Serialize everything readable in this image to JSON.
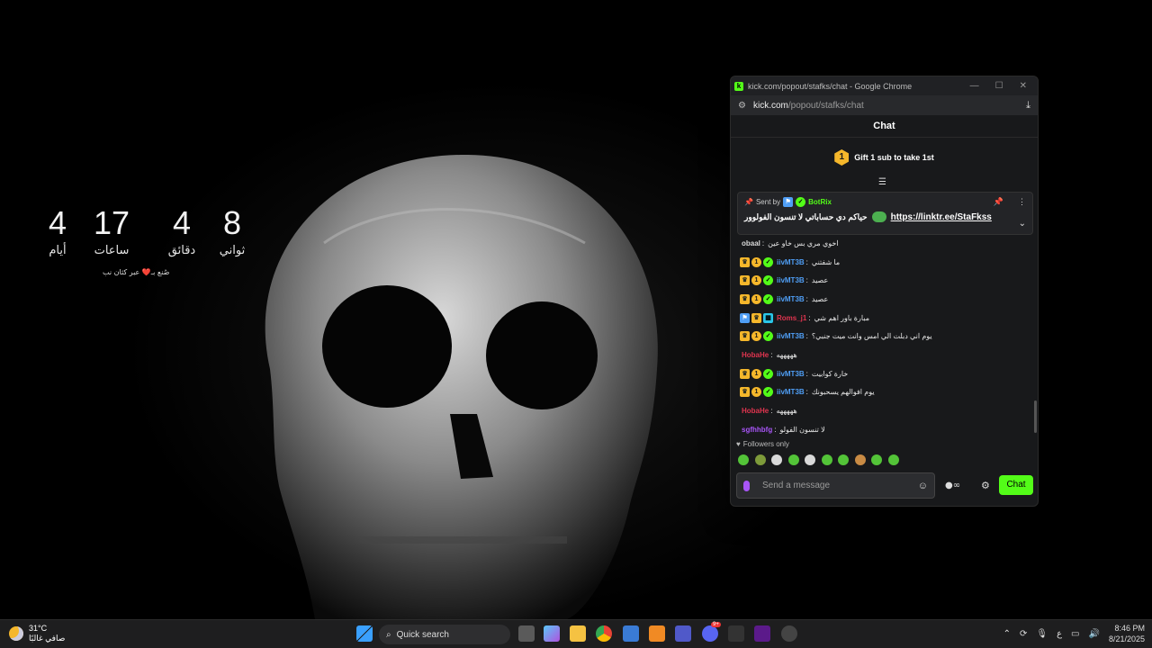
{
  "countdown": {
    "units": [
      {
        "value": "4",
        "label": "أيام"
      },
      {
        "value": "17",
        "label": "ساعات"
      },
      {
        "value": "4",
        "label": "دقائق"
      },
      {
        "value": "8",
        "label": "ثواني"
      }
    ],
    "footer": "صُنع بـ❤️ عبر كثان نب"
  },
  "window": {
    "title": "kick.com/popout/stafks/chat - Google Chrome",
    "url_host": "kick.com",
    "url_path": "/popout/stafks/chat"
  },
  "chat": {
    "header": "Chat",
    "gift_count": "1",
    "gift_text": "Gift 1 sub to take 1st",
    "pinned": {
      "sent_by_label": "Sent by",
      "sender": "BotRix",
      "message": "حياكم دي حساباتي لا تنسون الفولوور",
      "link": "https://linktr.ee/StaFkss"
    },
    "messages": [
      {
        "user": "obaal",
        "color": "#d9d9d9",
        "text": "اخوي مري بس خاو عين",
        "badges": []
      },
      {
        "user": "iivMT3B",
        "color": "#4f9ef5",
        "text": "ما شفتني",
        "badges": [
          "crown",
          "one",
          "verified"
        ]
      },
      {
        "user": "iivMT3B",
        "color": "#4f9ef5",
        "text": "عصيد",
        "badges": [
          "crown",
          "one",
          "verified"
        ]
      },
      {
        "user": "iivMT3B",
        "color": "#4f9ef5",
        "text": "عصيد",
        "badges": [
          "crown",
          "one",
          "verified"
        ]
      },
      {
        "user": "Roms_j1",
        "color": "#e0344f",
        "text": "مبارة باور اهم شي",
        "badges": [
          "blue",
          "crown",
          "og"
        ]
      },
      {
        "user": "iivMT3B",
        "color": "#4f9ef5",
        "text": "يوم اني دبلت الي امس وانت ميت جنبي؟",
        "badges": [
          "crown",
          "one",
          "verified"
        ]
      },
      {
        "user": "HobaHe",
        "color": "#e0344f",
        "text": "هههههه",
        "badges": []
      },
      {
        "user": "iivMT3B",
        "color": "#4f9ef5",
        "text": "خارة كوابيت",
        "badges": [
          "crown",
          "one",
          "verified"
        ]
      },
      {
        "user": "iivMT3B",
        "color": "#4f9ef5",
        "text": "يوم افوالهم يسحبونك",
        "badges": [
          "crown",
          "one",
          "verified"
        ]
      },
      {
        "user": "HobaHe",
        "color": "#e0344f",
        "text": "هههههه",
        "badges": []
      },
      {
        "user": "sgfhhbfg",
        "color": "#a855f7",
        "text": "لا تنسون الفولو",
        "badges": []
      }
    ],
    "followers_only": "Followers only",
    "input_placeholder": "Send a message",
    "send_label": "Chat"
  },
  "taskbar": {
    "temperature": "31°C",
    "weather": "صافي غالبًا",
    "search_placeholder": "Quick search",
    "time": "8:46 PM",
    "date": "8/21/2025",
    "lang": "ع",
    "discord_badge": "9+"
  },
  "colors": {
    "kick_green": "#53fc18",
    "gift_gold": "#f5b72b"
  }
}
